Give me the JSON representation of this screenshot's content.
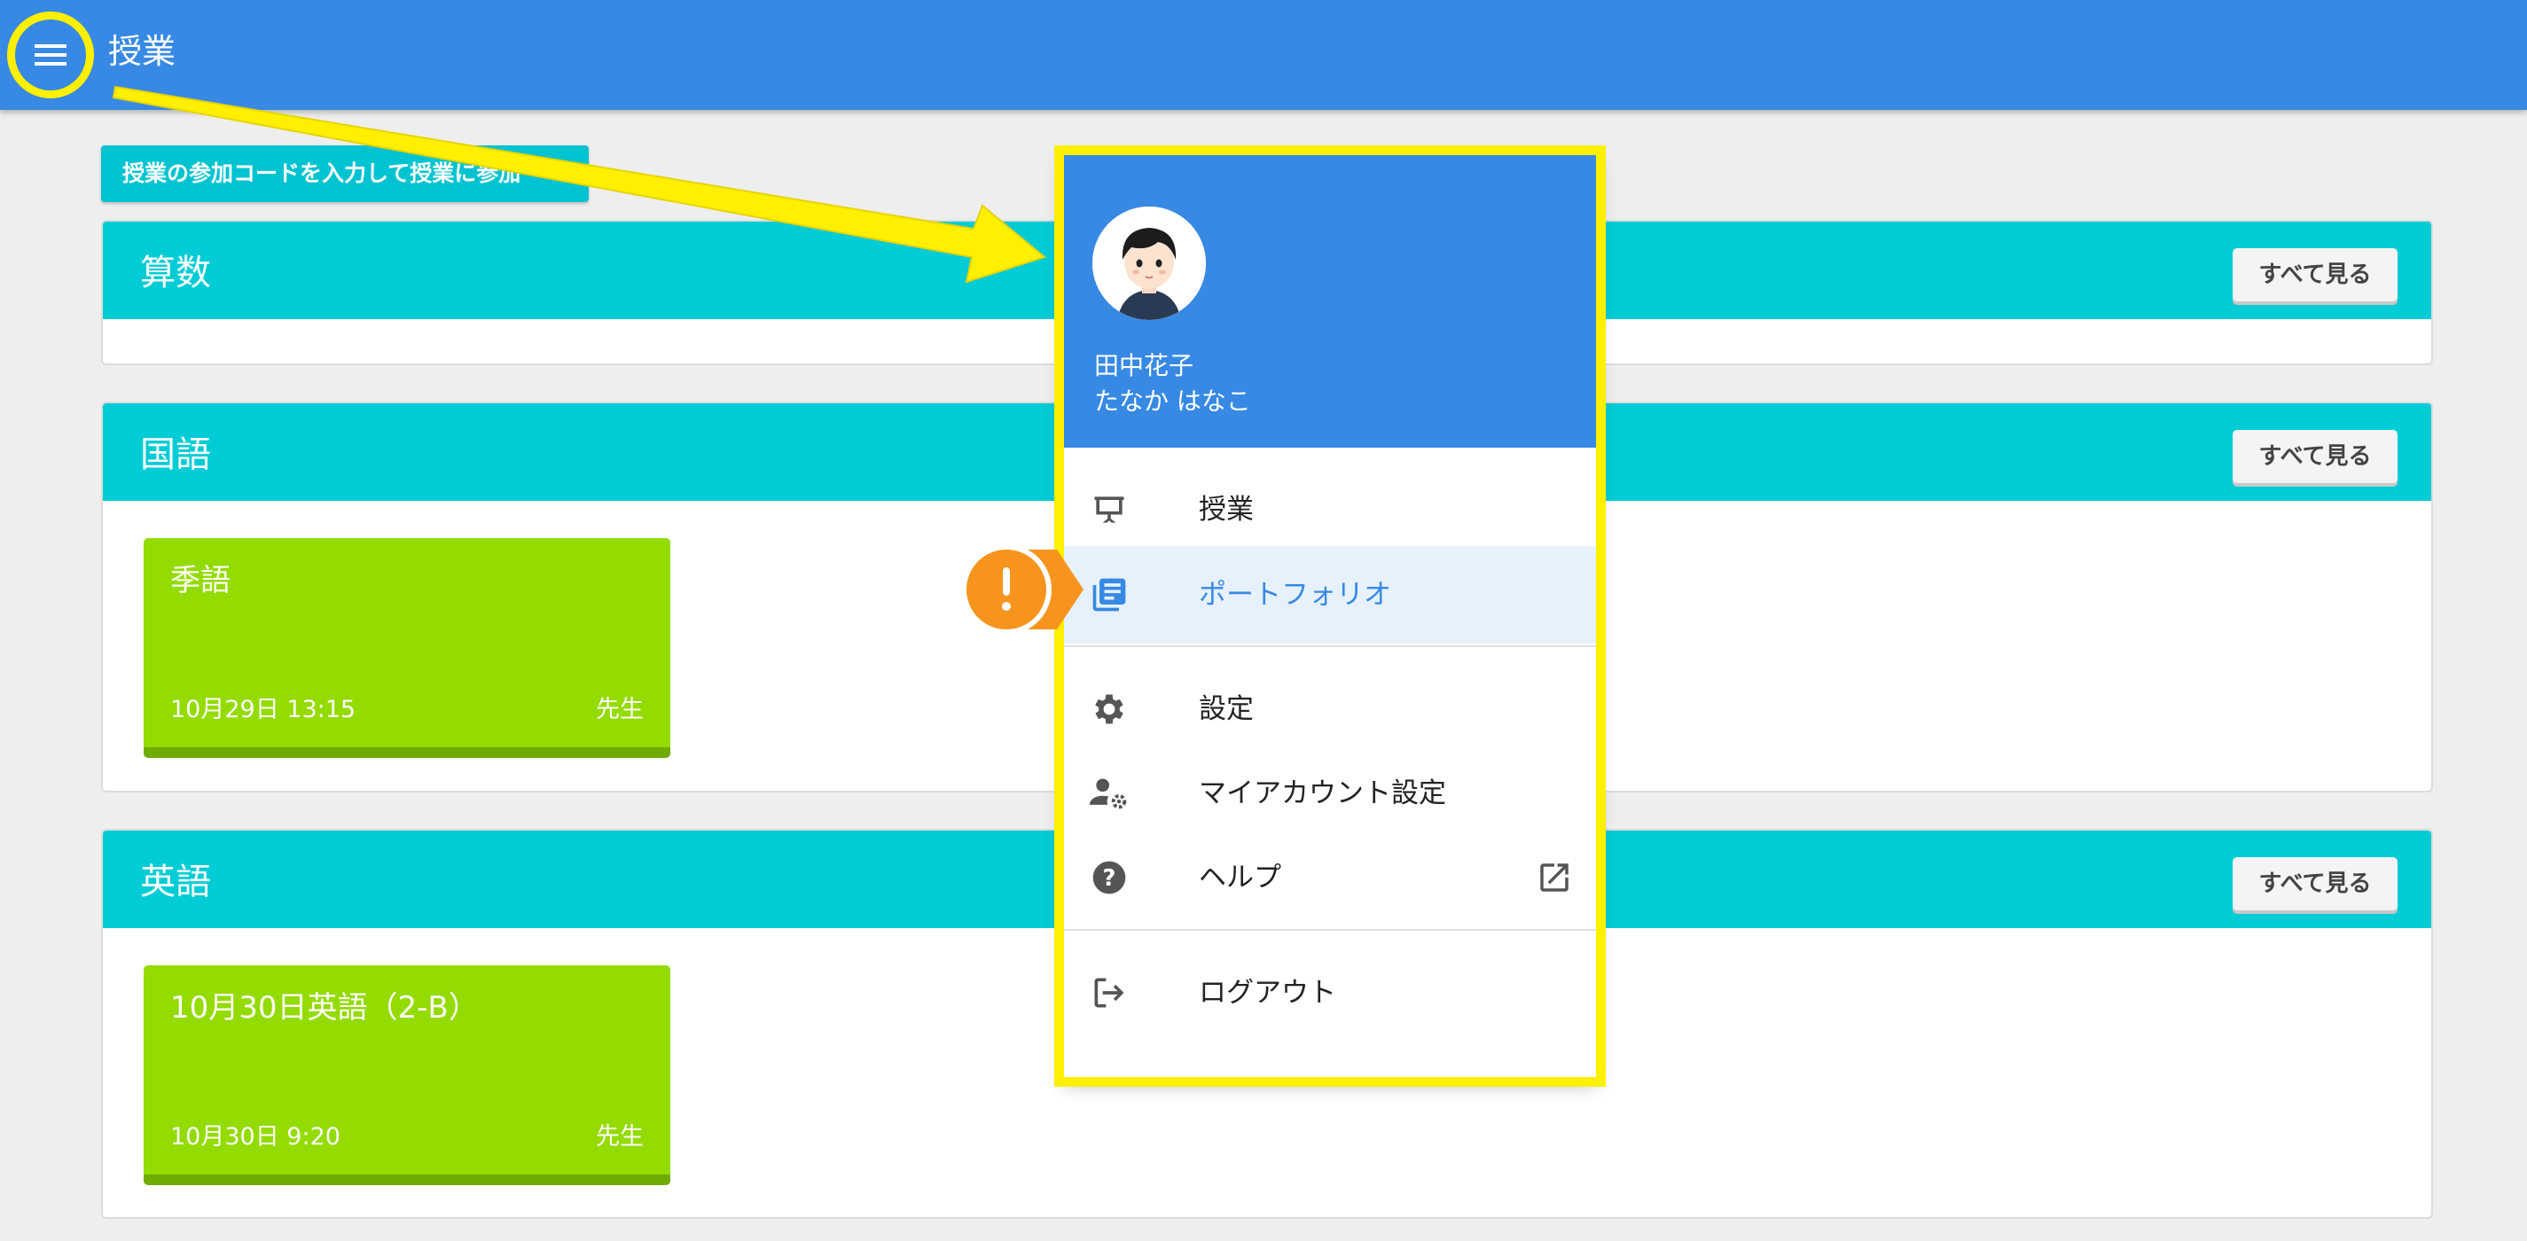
{
  "appbar": {
    "title": "授業"
  },
  "join": {
    "label": "授業の参加コードを入力して授業に参加"
  },
  "subjects": [
    {
      "title": "算数",
      "see_all": "すべて見る"
    },
    {
      "title": "国語",
      "see_all": "すべて見る",
      "lessons": [
        {
          "title": "季語",
          "date": "10月29日 13:15",
          "teacher": "先生"
        }
      ]
    },
    {
      "title": "英語",
      "see_all": "すべて見る",
      "lessons": [
        {
          "title": "10月30日英語（2-B）",
          "date": "10月30日 9:20",
          "teacher": "先生"
        }
      ]
    }
  ],
  "drawer": {
    "user": {
      "name": "田中花子",
      "kana": "たなか はなこ"
    },
    "items": [
      {
        "label": "授業",
        "icon": "presentation-icon"
      },
      {
        "label": "ポートフォリオ",
        "icon": "portfolio-icon",
        "active": true
      },
      {
        "label": "設定",
        "icon": "gear-icon"
      },
      {
        "label": "マイアカウント設定",
        "icon": "account-settings-icon"
      },
      {
        "label": "ヘルプ",
        "icon": "help-icon"
      },
      {
        "label": "ログアウト",
        "icon": "logout-icon"
      }
    ]
  },
  "colors": {
    "appbar": "#3789e3",
    "subject_header": "#00ccd6",
    "lesson_card": "#93db00",
    "highlight": "#ffef00",
    "callout": "#f7941d"
  }
}
